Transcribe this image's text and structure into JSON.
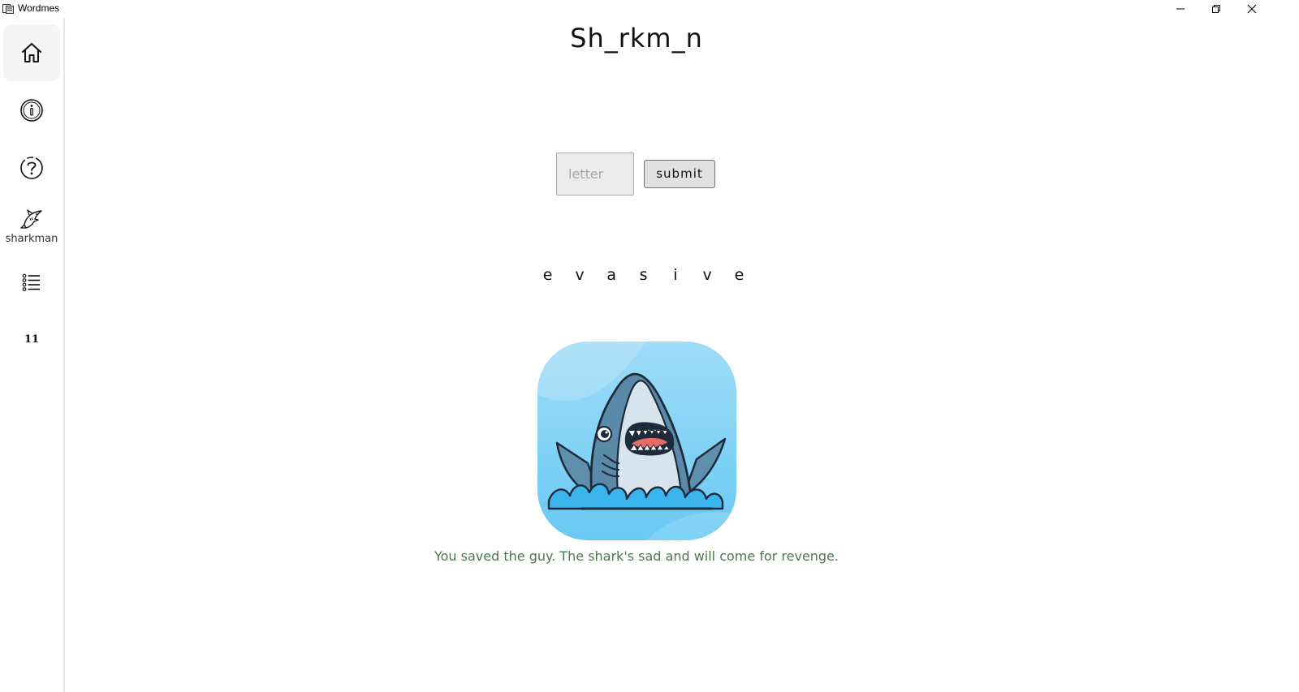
{
  "window": {
    "title": "Wordmes",
    "controls": [
      "minimize-icon",
      "restore-icon",
      "close-icon"
    ]
  },
  "sidebar": {
    "items": [
      {
        "name": "home",
        "icon": "home-icon",
        "active": true
      },
      {
        "name": "info",
        "icon": "info-icon",
        "active": false
      },
      {
        "name": "help",
        "icon": "help-icon",
        "active": false
      },
      {
        "name": "sharkman",
        "icon": "shark-icon",
        "label": "sharkman",
        "active": false
      },
      {
        "name": "list",
        "icon": "list-icon",
        "active": false
      },
      {
        "name": "count",
        "value": "11",
        "active": false
      }
    ]
  },
  "game": {
    "puzzle": "Sh_rkm_n",
    "input": {
      "value": "",
      "placeholder": "letter"
    },
    "submit_label": "submit",
    "word_letters": [
      "e",
      "v",
      "a",
      "s",
      "i",
      "v",
      "e"
    ],
    "image": "shark-illustration",
    "result_message": "You saved the guy. The shark's sad and will come for revenge."
  },
  "colors": {
    "result_text": "#4a7a4a",
    "card_bg_light": "#b6e4fb",
    "card_bg_dark": "#6fcdf5",
    "shark_body": "#5b8aa8",
    "shark_belly": "#d7e4ee"
  }
}
